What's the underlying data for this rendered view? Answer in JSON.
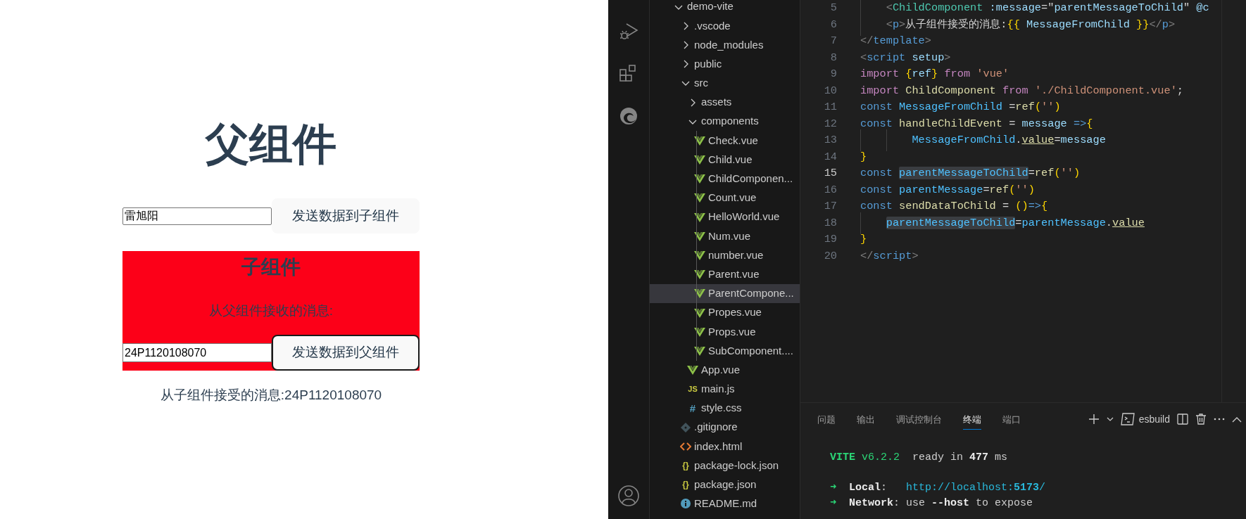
{
  "app": {
    "title": "父组件",
    "parent_input": {
      "value": "雷旭阳"
    },
    "parent_button": "发送数据到子组件",
    "child": {
      "title": "子组件",
      "message_label": "从父组件接收的消息:",
      "input": {
        "value": "24P1120108070"
      },
      "button": "发送数据到父组件"
    },
    "received": "从子组件接受的消息:24P1120108070"
  },
  "explorer": {
    "tree": [
      {
        "label": "demo-vite",
        "kind": "folder",
        "expanded": true,
        "selected": false,
        "children": [
          {
            "label": ".vscode",
            "kind": "folder",
            "expanded": false,
            "selected": false
          },
          {
            "label": "node_modules",
            "kind": "folder",
            "expanded": false,
            "selected": false
          },
          {
            "label": "public",
            "kind": "folder",
            "expanded": false,
            "selected": false
          },
          {
            "label": "src",
            "kind": "folder",
            "expanded": true,
            "selected": false,
            "children": [
              {
                "label": "assets",
                "kind": "folder",
                "expanded": false,
                "selected": false
              },
              {
                "label": "components",
                "kind": "folder",
                "expanded": true,
                "selected": false,
                "children": [
                  {
                    "label": "Check.vue",
                    "kind": "vue",
                    "selected": false
                  },
                  {
                    "label": "Child.vue",
                    "kind": "vue",
                    "selected": false
                  },
                  {
                    "label": "ChildComponen...",
                    "kind": "vue",
                    "selected": false
                  },
                  {
                    "label": "Count.vue",
                    "kind": "vue",
                    "selected": false
                  },
                  {
                    "label": "HelloWorld.vue",
                    "kind": "vue",
                    "selected": false
                  },
                  {
                    "label": "Num.vue",
                    "kind": "vue",
                    "selected": false
                  },
                  {
                    "label": "number.vue",
                    "kind": "vue",
                    "selected": false
                  },
                  {
                    "label": "Parent.vue",
                    "kind": "vue",
                    "selected": false
                  },
                  {
                    "label": "ParentCompone...",
                    "kind": "vue",
                    "selected": true
                  },
                  {
                    "label": "Propes.vue",
                    "kind": "vue",
                    "selected": false
                  },
                  {
                    "label": "Props.vue",
                    "kind": "vue",
                    "selected": false
                  },
                  {
                    "label": "SubComponent....",
                    "kind": "vue",
                    "selected": false
                  }
                ]
              },
              {
                "label": "App.vue",
                "kind": "vue",
                "selected": false
              },
              {
                "label": "main.js",
                "kind": "js",
                "icon": "JS",
                "selected": false
              },
              {
                "label": "style.css",
                "kind": "css",
                "icon": "#",
                "selected": false
              }
            ]
          },
          {
            "label": ".gitignore",
            "kind": "git",
            "selected": false
          },
          {
            "label": "index.html",
            "kind": "html",
            "selected": false
          },
          {
            "label": "package-lock.json",
            "kind": "json",
            "icon": "{}",
            "selected": false
          },
          {
            "label": "package.json",
            "kind": "json",
            "icon": "{}",
            "selected": false
          },
          {
            "label": "README.md",
            "kind": "info",
            "selected": false
          }
        ]
      }
    ]
  },
  "editor": {
    "lines": [
      {
        "number": "5",
        "current": false,
        "tokens": [
          {
            "text": "    <",
            "kind": "punct"
          },
          {
            "text": "ChildComponent",
            "kind": "tag"
          },
          {
            "text": " :message",
            "kind": "attr"
          },
          {
            "text": "=\"",
            "kind": "plain"
          },
          {
            "text": "parentMessageToChild",
            "kind": "var"
          },
          {
            "text": "\" ",
            "kind": "plain"
          },
          {
            "text": "@c",
            "kind": "attr"
          }
        ]
      },
      {
        "number": "6",
        "current": false,
        "tokens": [
          {
            "text": "    <",
            "kind": "punct"
          },
          {
            "text": "p",
            "kind": "tagname"
          },
          {
            "text": ">",
            "kind": "punct"
          },
          {
            "text": "从子组件接受的消息:",
            "kind": "plain"
          },
          {
            "text": "{{",
            "kind": "brace"
          },
          {
            "text": " MessageFromChild ",
            "kind": "var"
          },
          {
            "text": "}}",
            "kind": "brace"
          },
          {
            "text": "</",
            "kind": "punct"
          },
          {
            "text": "p",
            "kind": "tagname"
          },
          {
            "text": ">",
            "kind": "punct"
          }
        ]
      },
      {
        "number": "7",
        "current": false,
        "tokens": [
          {
            "text": "</",
            "kind": "punct"
          },
          {
            "text": "template",
            "kind": "tagname"
          },
          {
            "text": ">",
            "kind": "punct"
          }
        ]
      },
      {
        "number": "8",
        "current": false,
        "tokens": [
          {
            "text": "<",
            "kind": "punct"
          },
          {
            "text": "script",
            "kind": "tagname"
          },
          {
            "text": " setup",
            "kind": "attr"
          },
          {
            "text": ">",
            "kind": "punct"
          }
        ]
      },
      {
        "number": "9",
        "current": false,
        "tokens": [
          {
            "text": "import ",
            "kind": "kw"
          },
          {
            "text": "{",
            "kind": "brace"
          },
          {
            "text": "ref",
            "kind": "var"
          },
          {
            "text": "}",
            "kind": "brace"
          },
          {
            "text": " from",
            "kind": "kw"
          },
          {
            "text": " 'vue'",
            "kind": "str"
          }
        ]
      },
      {
        "number": "10",
        "current": false,
        "tokens": [
          {
            "text": "import",
            "kind": "kw"
          },
          {
            "text": " ChildComponent ",
            "kind": "cls"
          },
          {
            "text": "from",
            "kind": "kw"
          },
          {
            "text": " './ChildComponent.vue'",
            "kind": "str"
          },
          {
            "text": ";",
            "kind": "plain"
          }
        ]
      },
      {
        "number": "11",
        "current": false,
        "tokens": [
          {
            "text": "const",
            "kind": "decl"
          },
          {
            "text": " MessageFromChild ",
            "kind": "const"
          },
          {
            "text": "=",
            "kind": "plain"
          },
          {
            "text": "ref",
            "kind": "fn"
          },
          {
            "text": "(",
            "kind": "brace"
          },
          {
            "text": "''",
            "kind": "str"
          },
          {
            "text": ")",
            "kind": "brace"
          }
        ]
      },
      {
        "number": "12",
        "current": false,
        "tokens": [
          {
            "text": "const",
            "kind": "decl"
          },
          {
            "text": " handleChildEvent ",
            "kind": "fn"
          },
          {
            "text": "= ",
            "kind": "plain"
          },
          {
            "text": "message",
            "kind": "var"
          },
          {
            "text": " =>",
            "kind": "decl"
          },
          {
            "text": "{",
            "kind": "brace"
          }
        ]
      },
      {
        "number": "13",
        "current": false,
        "tokens": [
          {
            "text": "        MessageFromChild",
            "kind": "const"
          },
          {
            "text": ".",
            "kind": "plain"
          },
          {
            "text": "value",
            "kind": "prop"
          },
          {
            "text": "=",
            "kind": "plain"
          },
          {
            "text": "message",
            "kind": "var"
          }
        ]
      },
      {
        "number": "14",
        "current": false,
        "tokens": [
          {
            "text": "}",
            "kind": "brace"
          }
        ]
      },
      {
        "number": "15",
        "current": true,
        "tokens": [
          {
            "text": "const ",
            "kind": "decl"
          },
          {
            "text": "parentMessageToChild",
            "kind": "const_hl"
          },
          {
            "text": "=",
            "kind": "plain"
          },
          {
            "text": "ref",
            "kind": "fn"
          },
          {
            "text": "(",
            "kind": "brace"
          },
          {
            "text": "''",
            "kind": "str"
          },
          {
            "text": ")",
            "kind": "brace"
          }
        ]
      },
      {
        "number": "16",
        "current": false,
        "tokens": [
          {
            "text": "const ",
            "kind": "decl"
          },
          {
            "text": "parentMessage",
            "kind": "const"
          },
          {
            "text": "=",
            "kind": "plain"
          },
          {
            "text": "ref",
            "kind": "fn"
          },
          {
            "text": "(",
            "kind": "brace"
          },
          {
            "text": "''",
            "kind": "str"
          },
          {
            "text": ")",
            "kind": "brace"
          }
        ]
      },
      {
        "number": "17",
        "current": false,
        "tokens": [
          {
            "text": "const ",
            "kind": "decl"
          },
          {
            "text": "sendDataToChild ",
            "kind": "fn"
          },
          {
            "text": "= ",
            "kind": "plain"
          },
          {
            "text": "()",
            "kind": "brace"
          },
          {
            "text": "=>",
            "kind": "decl"
          },
          {
            "text": "{",
            "kind": "brace"
          }
        ]
      },
      {
        "number": "18",
        "current": false,
        "tokens": [
          {
            "text": "    parentMessageToChild",
            "kind": "const_hl"
          },
          {
            "text": "=",
            "kind": "plain"
          },
          {
            "text": "parentMessage",
            "kind": "const"
          },
          {
            "text": ".",
            "kind": "plain"
          },
          {
            "text": "value",
            "kind": "prop"
          }
        ]
      },
      {
        "number": "19",
        "current": false,
        "tokens": [
          {
            "text": "}",
            "kind": "brace"
          }
        ]
      },
      {
        "number": "20",
        "current": false,
        "tokens": [
          {
            "text": "</",
            "kind": "punct"
          },
          {
            "text": "script",
            "kind": "tagname"
          },
          {
            "text": ">",
            "kind": "punct"
          }
        ]
      }
    ]
  },
  "panel": {
    "tabs": [
      {
        "label": "问题",
        "selected": false
      },
      {
        "label": "输出",
        "selected": false
      },
      {
        "label": "调试控制台",
        "selected": false
      },
      {
        "label": "终端",
        "selected": true
      },
      {
        "label": "端口",
        "selected": false
      }
    ],
    "terminal_name": "esbuild",
    "terminal": [
      [
        [
          {
            "text": "VITE",
            "kind": "green_bold"
          },
          {
            "text": " v6.2.2",
            "kind": "green"
          },
          {
            "text": "  ready in ",
            "kind": "text"
          },
          {
            "text": "477",
            "kind": "bold"
          },
          {
            "text": " ms",
            "kind": "text"
          }
        ]
      ],
      [
        [
          {
            "text": "➜",
            "kind": "green"
          },
          {
            "text": "  Local",
            "kind": "bold"
          },
          {
            "text": ":   ",
            "kind": "text"
          },
          {
            "text": "http://localhost:",
            "kind": "cyan"
          },
          {
            "text": "5173",
            "kind": "cyan_bold"
          },
          {
            "text": "/",
            "kind": "cyan"
          }
        ],
        [
          {
            "text": "➜",
            "kind": "green"
          },
          {
            "text": "  Network",
            "kind": "bold"
          },
          {
            "text": ": use ",
            "kind": "text"
          },
          {
            "text": "--host",
            "kind": "bold"
          },
          {
            "text": " to expose",
            "kind": "text"
          }
        ]
      ]
    ]
  }
}
